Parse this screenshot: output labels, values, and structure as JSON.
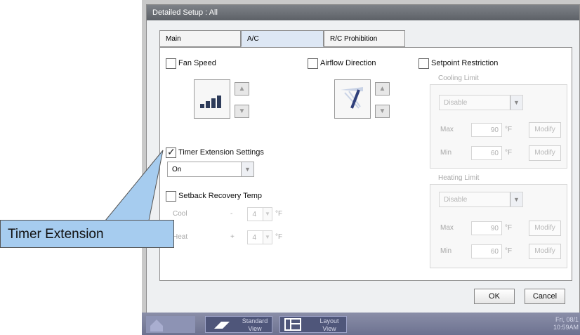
{
  "dialog": {
    "title": "Detailed Setup : All"
  },
  "tabs": [
    {
      "label": "Main"
    },
    {
      "label": "A/C"
    },
    {
      "label": "R/C Prohibition"
    }
  ],
  "fan_speed": {
    "label": "Fan Speed",
    "checked": false
  },
  "airflow": {
    "label": "Airflow Direction",
    "checked": false
  },
  "setpoint": {
    "label": "Setpoint Restriction",
    "checked": false,
    "cooling": {
      "title": "Cooling Limit",
      "mode": "Disable",
      "max_label": "Max",
      "max_value": "90",
      "min_label": "Min",
      "min_value": "60",
      "unit": "°F",
      "modify_label": "Modify"
    },
    "heating": {
      "title": "Heating Limit",
      "mode": "Disable",
      "max_label": "Max",
      "max_value": "90",
      "min_label": "Min",
      "min_value": "60",
      "unit": "°F",
      "modify_label": "Modify"
    }
  },
  "timer_ext": {
    "label": "Timer Extension Settings",
    "checked": true,
    "value": "On"
  },
  "setback": {
    "label": "Setback Recovery Temp",
    "checked": false,
    "cool": {
      "label": "Cool",
      "sign": "-",
      "value": "4",
      "unit": "°F"
    },
    "heat": {
      "label": "Heat",
      "sign": "+",
      "value": "4",
      "unit": "°F"
    }
  },
  "buttons": {
    "ok": "OK",
    "cancel": "Cancel"
  },
  "taskbar": {
    "standard_view": "Standard View",
    "layout_view": "Layout View",
    "datetime": "Fri, 08/1 10:59AM"
  },
  "callout": {
    "text": "Timer Extension"
  }
}
